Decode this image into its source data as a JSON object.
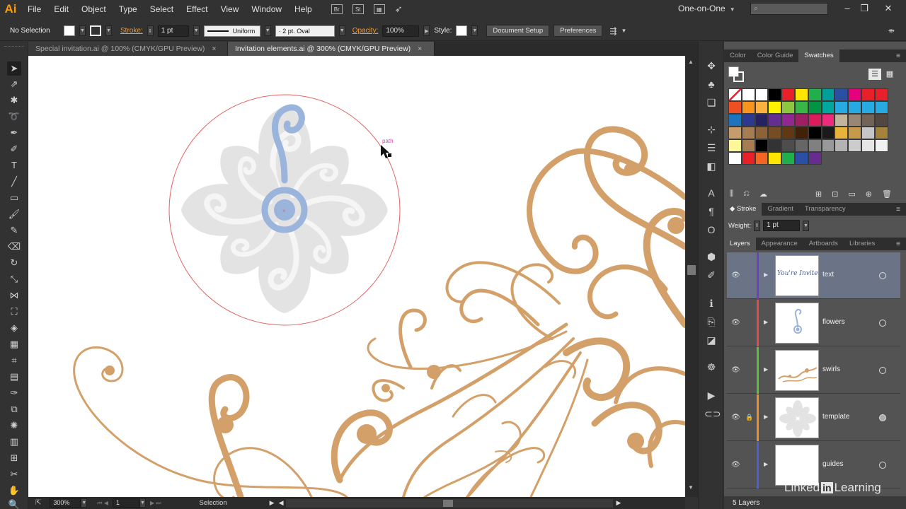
{
  "app": {
    "logo": "Ai",
    "workspace": "One-on-One"
  },
  "menu": [
    "File",
    "Edit",
    "Object",
    "Type",
    "Select",
    "Effect",
    "View",
    "Window",
    "Help"
  ],
  "menu_icons": [
    "Br",
    "St"
  ],
  "control": {
    "selection": "No Selection",
    "stroke_label": "Stroke:",
    "stroke_weight": "1 pt",
    "profile": "Uniform",
    "brush": "2 pt. Oval",
    "opacity_label": "Opacity:",
    "opacity": "100%",
    "style_label": "Style:",
    "document_setup": "Document Setup",
    "preferences": "Preferences"
  },
  "tabs": [
    {
      "label": "Special invitation.ai @ 100% (CMYK/GPU Preview)",
      "close": "×"
    },
    {
      "label": "Invitation elements.ai @ 300% (CMYK/GPU Preview)",
      "close": "×"
    }
  ],
  "canvas": {
    "path_label": "path"
  },
  "status": {
    "zoom": "300%",
    "artboard": "1",
    "mode": "Selection"
  },
  "color_panel": {
    "tabs": [
      "Color",
      "Color Guide",
      "Swatches"
    ],
    "active": "Swatches",
    "swatch_rows": [
      [
        "#ffffff",
        "#ffffff",
        "#ffffff",
        "#000000",
        "#e8202a",
        "#ffe500",
        "#1fb04b",
        "#00a09a",
        "#2a4fa3",
        "#e6007e",
        "#e8202a",
        "#e8202a"
      ],
      [
        "#f04e23",
        "#f7941d",
        "#fbb040",
        "#fff200",
        "#8dc63f",
        "#39b54a",
        "#009444",
        "#00a79d",
        "#27aae1",
        "#27aae1",
        "#27aae1",
        "#27aae1"
      ],
      [
        "#1c75bc",
        "#2b3990",
        "#262262",
        "#662d91",
        "#92278f",
        "#9e1f63",
        "#da1c5c",
        "#ee2a7b",
        "#c2b59b",
        "#998675",
        "#736357",
        "#534741"
      ],
      [
        "#c69c6d",
        "#a67c52",
        "#8c6239",
        "#754c24",
        "#603913",
        "#42210b",
        "#000000",
        "#1a1a1a",
        "#e8b33a",
        "#c59a4b",
        "#c6c6c6",
        "#a6833a"
      ],
      [
        "#fff799",
        "#a67c52",
        "#000000",
        "#333333",
        "#4d4d4d",
        "#666666",
        "#808080",
        "#999999",
        "#b3b3b3",
        "#cccccc",
        "#e6e6e6",
        "#f2f2f2"
      ],
      [
        "#ffffff",
        "#e8202a",
        "#f26522",
        "#ffe500",
        "#1fb04b",
        "#2a4fa3",
        "#662d91"
      ]
    ]
  },
  "stroke_panel": {
    "tabs": [
      "Stroke",
      "Gradient",
      "Transparency"
    ],
    "weight_label": "Weight:",
    "weight": "1 pt"
  },
  "layers_panel": {
    "tabs": [
      "Layers",
      "Appearance",
      "Artboards",
      "Libraries"
    ],
    "layers": [
      {
        "name": "text",
        "color": "#6e3fbf",
        "locked": false,
        "selected": true,
        "thumb_text": "You're Invited"
      },
      {
        "name": "flowers",
        "color": "#e84a4a",
        "locked": false,
        "selected": false,
        "thumb_text": ""
      },
      {
        "name": "swirls",
        "color": "#5bbf3a",
        "locked": false,
        "selected": false,
        "thumb_text": ""
      },
      {
        "name": "template",
        "color": "#f28c28",
        "locked": true,
        "selected": false,
        "thumb_text": ""
      },
      {
        "name": "guides",
        "color": "#4a5fd8",
        "locked": false,
        "selected": false,
        "thumb_text": ""
      }
    ],
    "footer": "5 Layers"
  },
  "watermark": {
    "pre": "Linked",
    "in": "in",
    "post": "Learning"
  },
  "colors": {
    "swirl": "#d4a06a",
    "template_gray": "#e3e3e3",
    "flower_blue": "#9ab4dc",
    "circle_red": "#e46262",
    "accent_orange": "#f39a2c"
  }
}
